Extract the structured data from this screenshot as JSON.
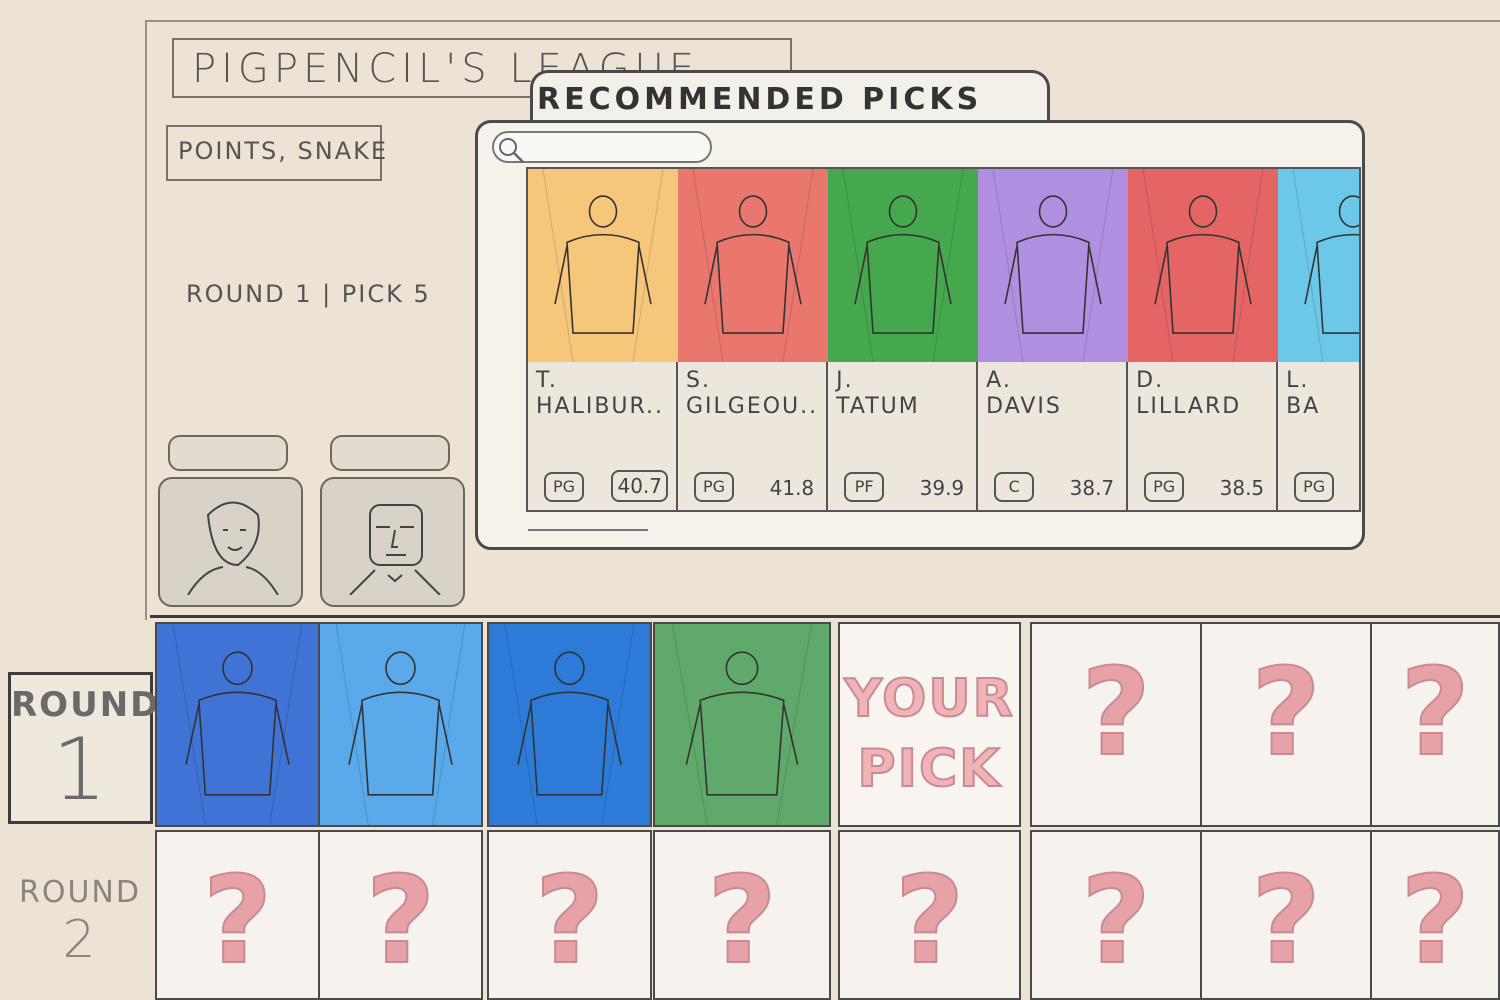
{
  "league": {
    "title": "PIGPENCIL'S LEAGUE",
    "format": "POINTS, SNAKE",
    "draft_position": "ROUND 1 | PICK 5"
  },
  "drafters": [
    {
      "id": "drafter-1"
    },
    {
      "id": "drafter-2"
    }
  ],
  "popup": {
    "title": "RECOMMENDED PICKS",
    "search_icon": "magnifier-icon",
    "players": [
      {
        "first": "T.",
        "last": "HALIBUR..",
        "position": "PG",
        "points": "40.7",
        "color": "#f6c77b"
      },
      {
        "first": "S.",
        "last": "GILGEOU..",
        "position": "PG",
        "points": "41.8",
        "color": "#e9776e"
      },
      {
        "first": "J.",
        "last": "TATUM",
        "position": "PF",
        "points": "39.9",
        "color": "#45a84d"
      },
      {
        "first": "A.",
        "last": "DAVIS",
        "position": "C",
        "points": "38.7",
        "color": "#b18fe0"
      },
      {
        "first": "D.",
        "last": "LILLARD",
        "position": "PG",
        "points": "38.5",
        "color": "#e56565"
      },
      {
        "first": "L.",
        "last": "BA",
        "position": "PG",
        "points": "",
        "color": "#6cc8e8"
      }
    ]
  },
  "board": {
    "round1_label": "ROUND",
    "round1_num": "1",
    "round2_label": "ROUND",
    "round2_num": "2",
    "your_pick": "YOUR PICK",
    "unknown_mark": "?",
    "picked_colors": [
      "#3f73d6",
      "#5aa9ea",
      "#2d7bd8",
      "#5faa6a"
    ]
  }
}
